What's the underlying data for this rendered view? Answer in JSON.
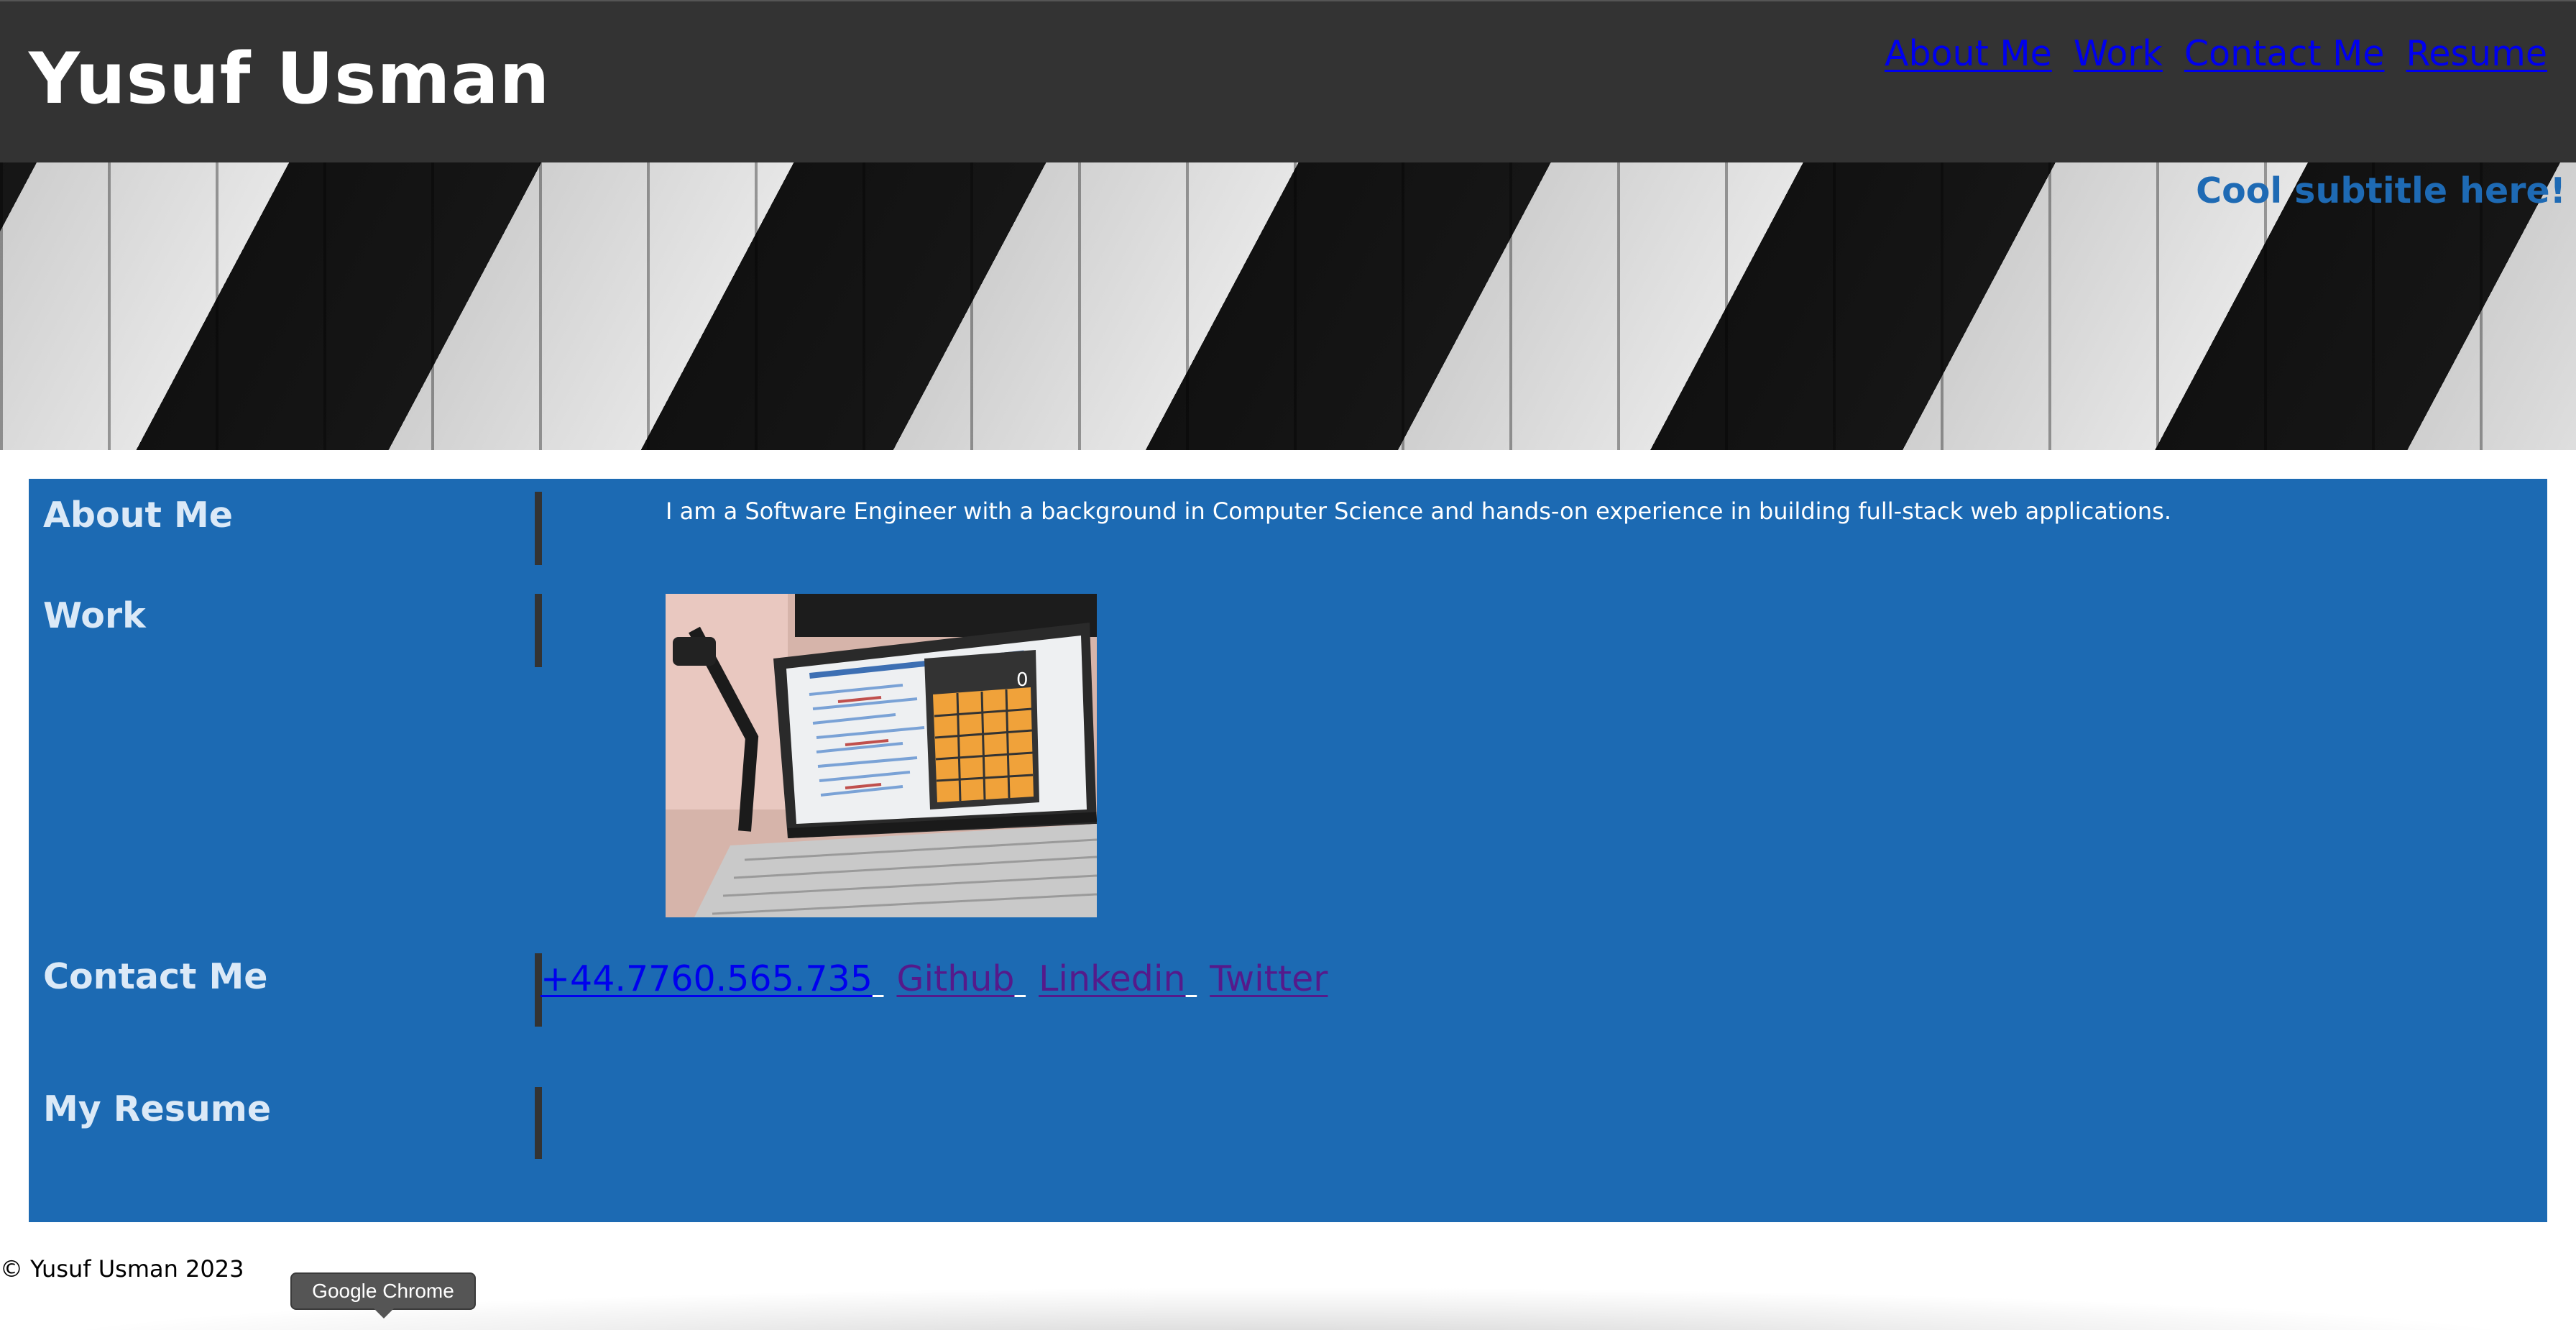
{
  "header": {
    "title": "Yusuf Usman",
    "nav": [
      {
        "label": "About Me"
      },
      {
        "label": "Work"
      },
      {
        "label": "Contact Me"
      },
      {
        "label": "Resume"
      }
    ]
  },
  "hero": {
    "subtitle": "Cool subtitle here!"
  },
  "sections": {
    "about": {
      "heading": "About Me",
      "text": "I am a Software Engineer with a background in Computer Science and hands-on experience in building full-stack web applications."
    },
    "work": {
      "heading": "Work",
      "image_icon": "laptop-calculator-photo"
    },
    "contact": {
      "heading": "Contact Me",
      "links": [
        {
          "label": "+44.7760.565.735"
        },
        {
          "label": "Github"
        },
        {
          "label": "Linkedin"
        },
        {
          "label": "Twitter"
        }
      ]
    },
    "resume": {
      "heading": "My Resume"
    }
  },
  "footer": {
    "text": "© Yusuf Usman 2023"
  },
  "tooltip": {
    "text": "Google Chrome"
  },
  "colors": {
    "header_bg": "#333333",
    "content_bg": "#1c6ab3",
    "heading_text": "#dbe9f7",
    "subtitle": "#1e6ab4",
    "link": "#0000ee",
    "visited_link": "#551a8b"
  }
}
